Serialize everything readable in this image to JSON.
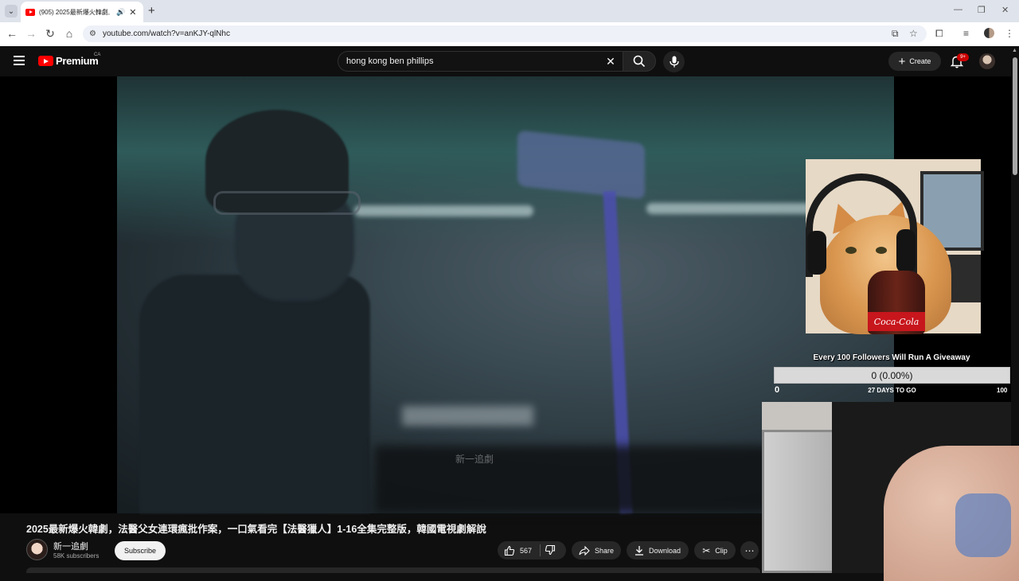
{
  "browser": {
    "tab_title": "(905) 2025最新爆火韓劇,",
    "tab_list_icon": "chevron-down-icon",
    "new_tab_label": "+",
    "url": "youtube.com/watch?v=anKJY-qlNhc"
  },
  "youtube": {
    "logo_text": "Premium",
    "region": "CA",
    "search_value": "hong kong ben phillips",
    "create_label": "Create",
    "notification_count": "9+"
  },
  "overlay": {
    "goal_title": "Every 100 Followers Will Run A Giveaway",
    "goal_value": "0 (0.00%)",
    "goal_progress": 0.0,
    "goal_min": "0",
    "goal_days": "27 DAYS TO GO",
    "goal_max": "100",
    "cola_label": "Coca-Cola"
  },
  "video": {
    "watermark": "新一追劇",
    "title": "2025最新爆火韓劇，法醫父女連環瘋批作案，一口氣看完【法醫獵人】1-16全集完整版，韓國電視劇解說",
    "channel_name": "新一追劇",
    "subscribers": "58K subscribers",
    "subscribe_label": "Subscribe",
    "likes": "567",
    "share_label": "Share",
    "download_label": "Download",
    "clip_label": "Clip"
  },
  "colors": {
    "youtube_red": "#ff0000",
    "background": "#0f0f0f",
    "pill": "#272727"
  }
}
